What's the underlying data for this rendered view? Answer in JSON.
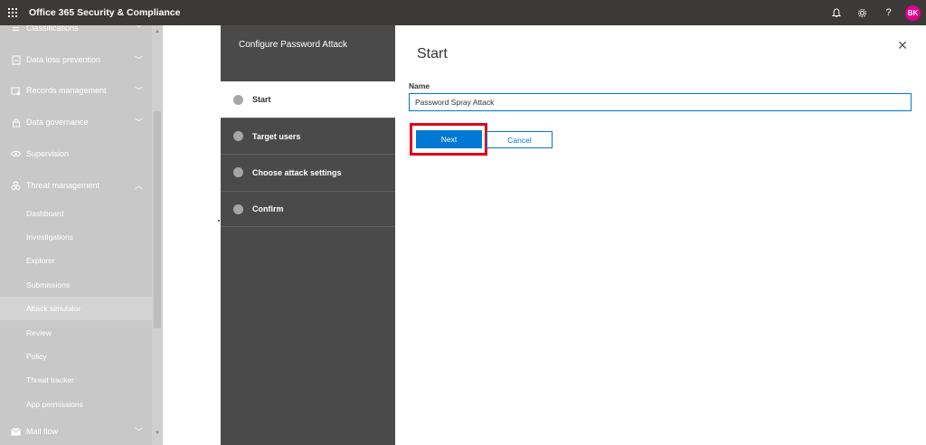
{
  "header": {
    "app_title": "Office 365 Security & Compliance",
    "icons": [
      "waffle-icon",
      "bell-icon",
      "gear-icon",
      "help-icon"
    ],
    "avatar_initials": "BK",
    "avatar_color": "#e3008c",
    "help_label": "?"
  },
  "sidebar": {
    "items": [
      {
        "label": "Classifications",
        "icon": "tag-icon",
        "expanded": false
      },
      {
        "label": "Data loss prevention",
        "icon": "dlp-icon",
        "expanded": false
      },
      {
        "label": "Records management",
        "icon": "records-icon",
        "expanded": false
      },
      {
        "label": "Data governance",
        "icon": "lock-icon",
        "expanded": false
      },
      {
        "label": "Supervision",
        "icon": "eye-icon"
      },
      {
        "label": "Threat management",
        "icon": "biohazard-icon",
        "expanded": true
      },
      {
        "label": "Mail flow",
        "icon": "mail-icon",
        "expanded": false
      }
    ],
    "threat_subitems": [
      "Dashboard",
      "Investigations",
      "Explorer",
      "Submissions",
      "Attack simulator",
      "Review",
      "Policy",
      "Threat tracker",
      "App permissions"
    ],
    "active_subitem": "Attack simulator"
  },
  "wizard": {
    "title": "Configure Password Attack",
    "steps": [
      {
        "label": "Start",
        "active": true
      },
      {
        "label": "Target users",
        "active": false
      },
      {
        "label": "Choose attack settings",
        "active": false
      },
      {
        "label": "Confirm",
        "active": false
      }
    ]
  },
  "form": {
    "page_title": "Start",
    "name_label": "Name",
    "name_value": "Password Spray Attack",
    "next_label": "Next",
    "cancel_label": "Cancel"
  },
  "colors": {
    "header_bg": "#3b3a39",
    "steps_panel_bg": "#4a4a4a",
    "accent": "#0078d4",
    "highlight": "#e0001b"
  }
}
